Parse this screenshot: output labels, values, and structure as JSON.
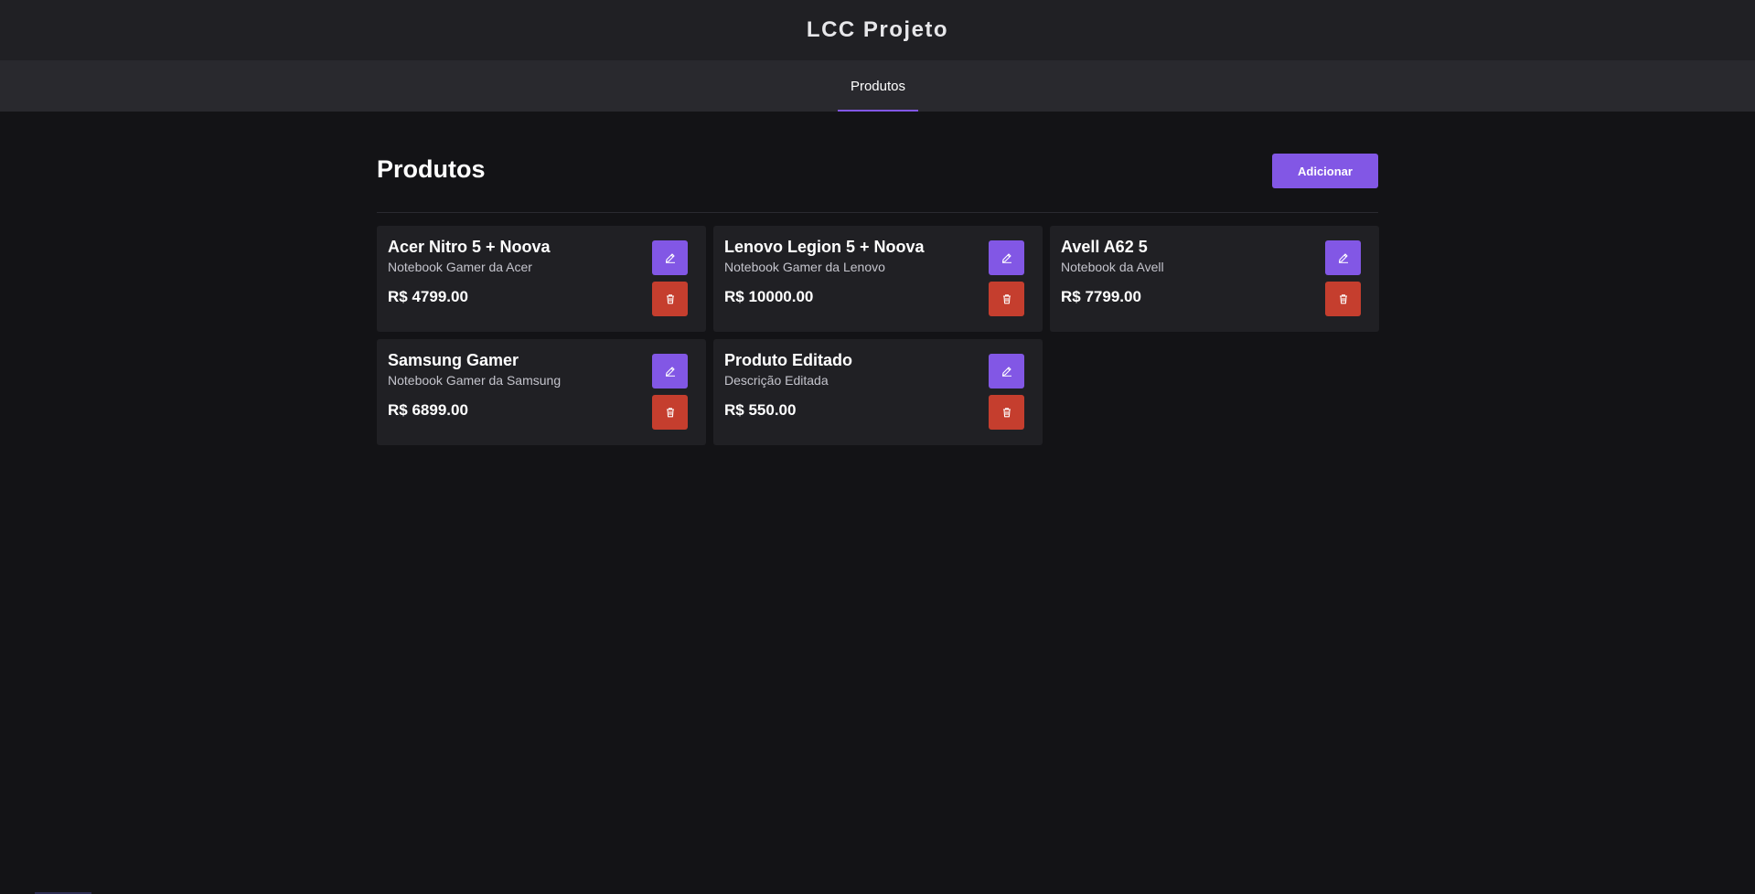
{
  "app": {
    "title": "LCC Projeto"
  },
  "nav": {
    "tabs": [
      {
        "label": "Produtos",
        "active": true
      }
    ]
  },
  "page": {
    "title": "Produtos",
    "add_label": "Adicionar"
  },
  "icons": {
    "edit": "pencil-icon",
    "delete": "trash-icon"
  },
  "colors": {
    "accent": "#8257e5",
    "danger": "#c53e2e",
    "card": "#202024",
    "background": "#131316"
  },
  "products": [
    {
      "name": "Acer Nitro 5 + Noova",
      "description": "Notebook Gamer da Acer",
      "price": "R$ 4799.00"
    },
    {
      "name": "Lenovo Legion 5 + Noova",
      "description": "Notebook Gamer da Lenovo",
      "price": "R$ 10000.00"
    },
    {
      "name": "Avell A62 5",
      "description": "Notebook da Avell",
      "price": "R$ 7799.00"
    },
    {
      "name": "Samsung Gamer",
      "description": "Notebook Gamer da Samsung",
      "price": "R$ 6899.00"
    },
    {
      "name": "Produto Editado",
      "description": "Descrição Editada",
      "price": "R$ 550.00"
    }
  ]
}
